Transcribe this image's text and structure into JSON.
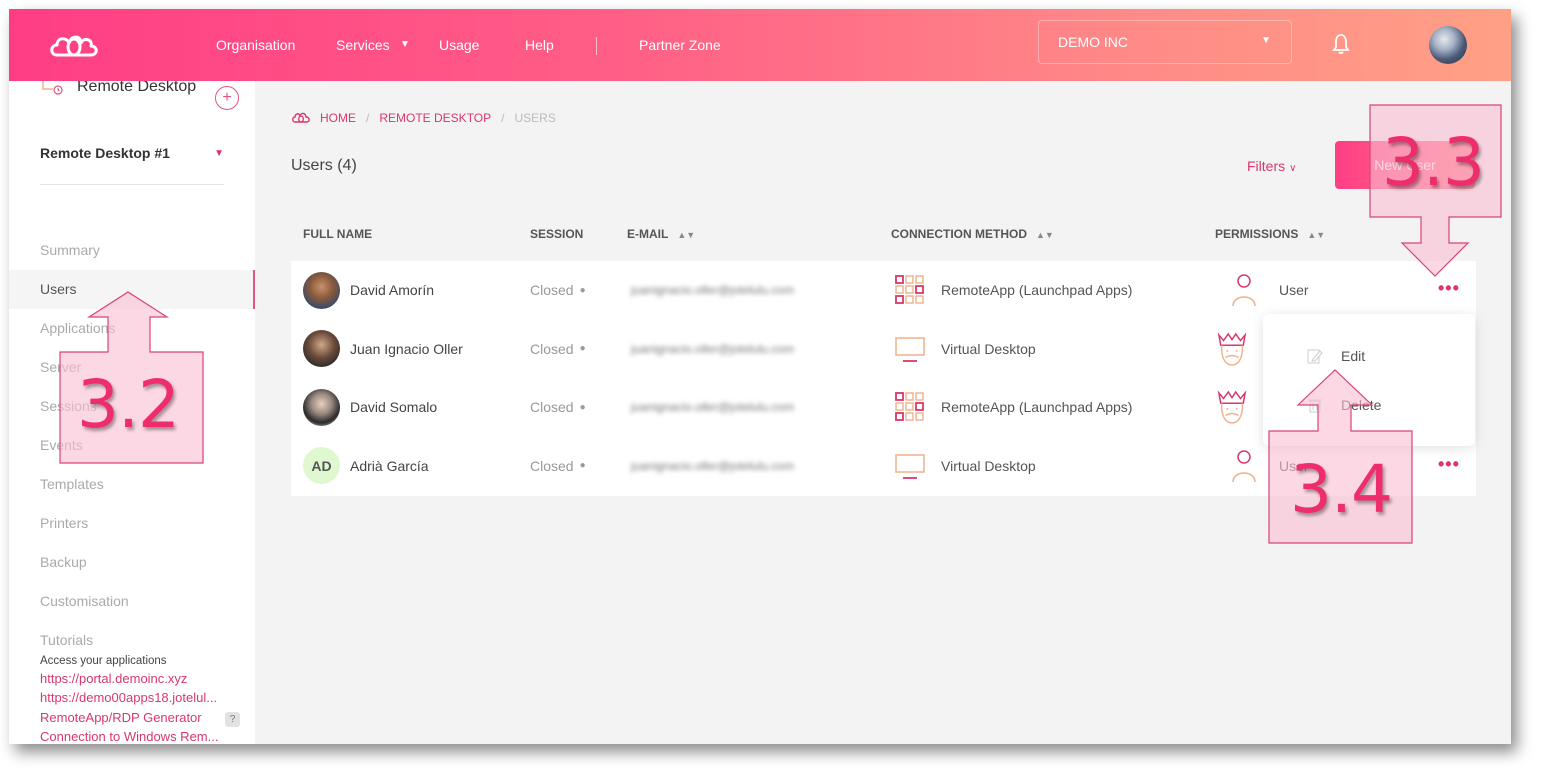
{
  "header": {
    "logo": "cloud-logo",
    "nav": [
      {
        "label": "Organisation"
      },
      {
        "label": "Services",
        "has_dropdown": true
      },
      {
        "label": "Usage"
      },
      {
        "label": "Help"
      },
      {
        "label": "Partner Zone"
      }
    ],
    "organization_select": {
      "value": "DEMO INC"
    },
    "icons": {
      "notifications": "bell-icon",
      "user": "user-avatar"
    }
  },
  "sidebar": {
    "service_title": "Remote Desktop",
    "add_button": "+",
    "instance": "Remote Desktop #1",
    "menu": [
      {
        "label": "Summary",
        "active": false
      },
      {
        "label": "Users",
        "active": true
      },
      {
        "label": "Applications",
        "active": false
      },
      {
        "label": "Server",
        "active": false
      },
      {
        "label": "Sessions",
        "active": false
      },
      {
        "label": "Events",
        "active": false
      },
      {
        "label": "Templates",
        "active": false
      },
      {
        "label": "Printers",
        "active": false
      },
      {
        "label": "Backup",
        "active": false
      },
      {
        "label": "Customisation",
        "active": false
      },
      {
        "label": "Tutorials",
        "active": false
      }
    ],
    "access": {
      "label": "Access your applications",
      "links": [
        "https://portal.demoinc.xyz",
        "https://demo00apps18.jotelul...",
        "RemoteApp/RDP Generator",
        "Connection to Windows Rem..."
      ],
      "help_badge": "?"
    }
  },
  "breadcrumb": [
    {
      "label": "HOME",
      "link": true
    },
    {
      "label": "REMOTE DESKTOP",
      "link": true
    },
    {
      "label": "USERS",
      "link": false
    }
  ],
  "breadcrumb_sep": "/",
  "page": {
    "title": "Users (4)",
    "filters_label": "Filters",
    "new_user_label": "New User"
  },
  "table": {
    "columns": [
      "FULL NAME",
      "SESSION",
      "E-MAIL",
      "CONNECTION METHOD",
      "PERMISSIONS"
    ],
    "rows": [
      {
        "name": "David Amorín",
        "avatar": "photo",
        "session": "Closed",
        "email": "juanignacio.oller@jotelulu.com",
        "connection": "RemoteApp (Launchpad Apps)",
        "connection_icon": "apps-grid-icon",
        "permission": "User",
        "permission_icon": "user-icon"
      },
      {
        "name": "Juan Ignacio Oller",
        "avatar": "photo",
        "session": "Closed",
        "email": "juanignacio.oller@jotelulu.com",
        "connection": "Virtual Desktop",
        "connection_icon": "monitor-icon",
        "permission": "",
        "permission_icon": "crown-admin-icon"
      },
      {
        "name": "David Somalo",
        "avatar": "photo",
        "session": "Closed",
        "email": "juanignacio.oller@jotelulu.com",
        "connection": "RemoteApp (Launchpad Apps)",
        "connection_icon": "apps-grid-icon",
        "permission": "",
        "permission_icon": "crown-admin-icon"
      },
      {
        "name": "Adrià García",
        "avatar": "AD",
        "session": "Closed",
        "email": "juanignacio.oller@jotelulu.com",
        "connection": "Virtual Desktop",
        "connection_icon": "monitor-icon",
        "permission": "User",
        "permission_icon": "user-icon"
      }
    ],
    "row_menu": "•••"
  },
  "context_menu": {
    "items": [
      {
        "label": "Edit",
        "icon": "edit-icon"
      },
      {
        "label": "Delete",
        "icon": "trash-icon"
      }
    ]
  },
  "annotations": [
    {
      "label": "3.2",
      "points_to": "Users menu item"
    },
    {
      "label": "3.3",
      "points_to": "row options menu"
    },
    {
      "label": "3.4",
      "points_to": "Edit option"
    }
  ],
  "colors": {
    "accent": "#e0336b",
    "header_gradient_start": "#ff3d85",
    "header_gradient_end": "#ffa085",
    "annotation": "#ee2e6c",
    "avatar_initials_bg": "#dff8d0"
  }
}
